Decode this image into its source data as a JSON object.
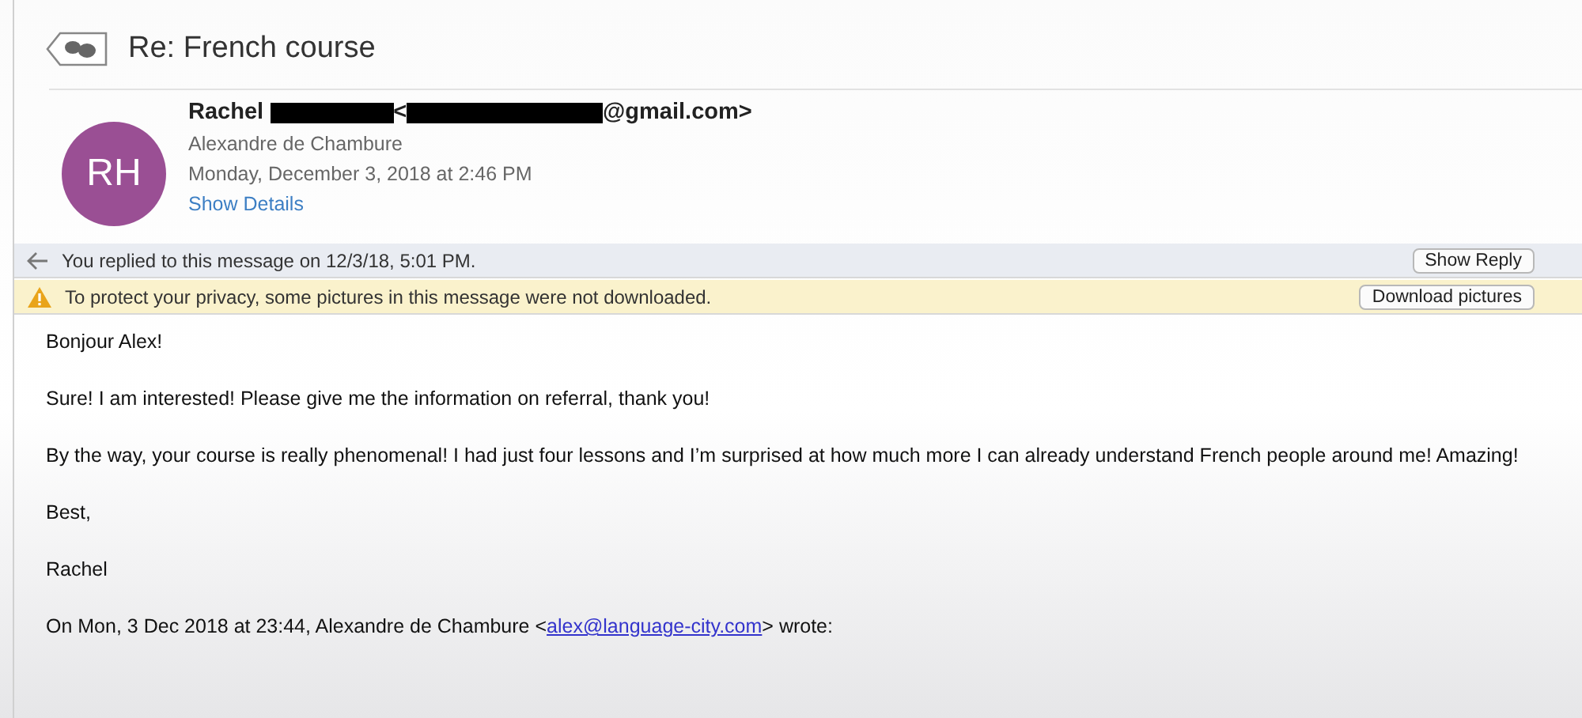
{
  "message": {
    "subject": "Re: French course",
    "avatar_initials": "RH",
    "sender": {
      "name": "Rachel",
      "address_open": "<",
      "address_tail": "@gmail.com>"
    },
    "recipient": "Alexandre de Chambure",
    "date": "Monday, December 3, 2018 at 2:46 PM",
    "details_link": "Show Details"
  },
  "notices": [
    {
      "kind": "replied",
      "text": "You replied to this message on 12/3/18, 5:01 PM.",
      "button": "Show Reply"
    },
    {
      "kind": "warning",
      "text": "To protect your privacy, some pictures in this message were not downloaded.",
      "button": "Download pictures"
    }
  ],
  "body": [
    {
      "kind": "text",
      "text": "Bonjour Alex!"
    },
    {
      "kind": "text",
      "text": "Sure! I am interested! Please give me the information on referral, thank you!"
    },
    {
      "kind": "text",
      "text": "By the way, your course is really phenomenal! I had just four lessons and I’m surprised at how much more I can already understand French people around me! Amazing!"
    },
    {
      "kind": "text",
      "text": "Best,"
    },
    {
      "kind": "text",
      "text": "Rachel"
    },
    {
      "kind": "quote",
      "before": "On Mon, 3 Dec 2018 at 23:44, Alexandre de Chambure <",
      "link": "alex@language-city.com",
      "after": "> wrote:"
    }
  ]
}
